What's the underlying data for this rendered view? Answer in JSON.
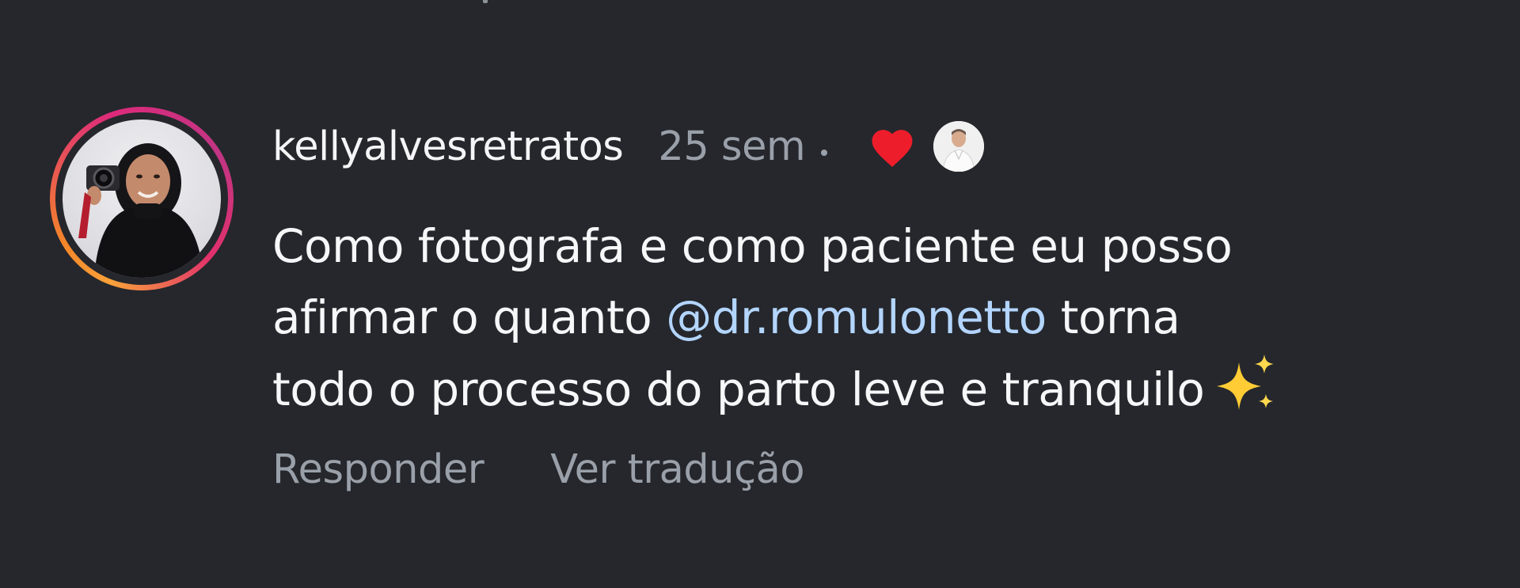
{
  "comment": {
    "username": "kellyalvesretratos",
    "timestamp": "25 sem",
    "text": {
      "line1": "Como fotografa e como paciente eu posso",
      "line2_before": "afirmar o quanto ",
      "mention": "@dr.romulonetto",
      "line2_after": " torna",
      "line3": "todo o processo do parto leve e tranquilo"
    },
    "emoji_icon": "sparkles-icon",
    "liked_by_creator": true,
    "like_icon": "heart-icon",
    "actions": {
      "reply": "Responder",
      "translate": "Ver tradução"
    }
  },
  "colors": {
    "background": "#25272c",
    "primary_text": "#f5f5f7",
    "secondary_text": "#9aa0a9",
    "mention": "#b3d5ff",
    "heart": "#ee1d2b",
    "story_ring_start": "#f9a23a",
    "story_ring_end": "#c13584"
  }
}
